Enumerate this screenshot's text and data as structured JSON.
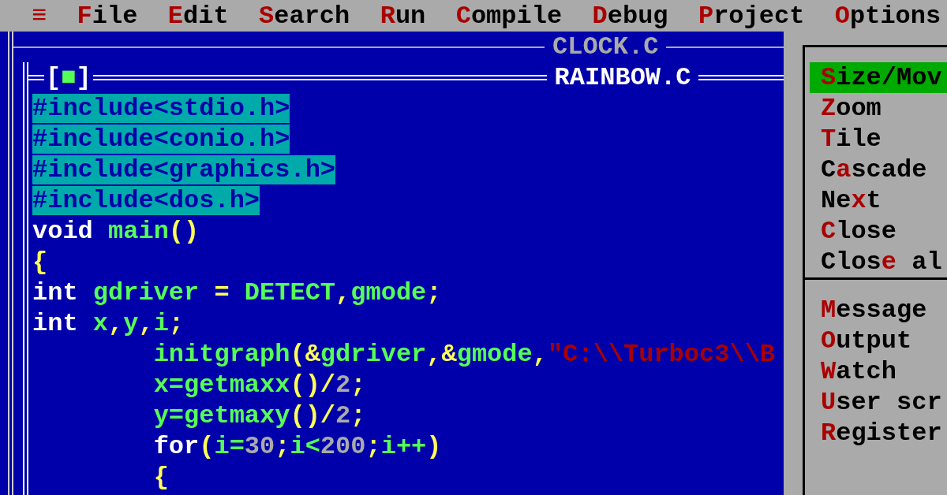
{
  "menu_bar": [
    {
      "key": "≡"
    },
    {
      "key": "F",
      "post": "ile"
    },
    {
      "key": "E",
      "post": "dit"
    },
    {
      "key": "S",
      "post": "earch"
    },
    {
      "key": "R",
      "post": "un"
    },
    {
      "key": "C",
      "post": "ompile"
    },
    {
      "key": "D",
      "post": "ebug"
    },
    {
      "key": "P",
      "post": "roject"
    },
    {
      "key": "O",
      "post": "ptions"
    }
  ],
  "windows": [
    {
      "title": "CLOCK.C",
      "active": false
    },
    {
      "title": "RAINBOW.C",
      "active": true,
      "close_box": {
        "open": "[",
        "mark": "■",
        "close": "]"
      }
    }
  ],
  "code_lines": [
    {
      "selected": true,
      "indented": false,
      "tokens": [
        {
          "kind": "pre",
          "text": "#include<stdio.h>"
        }
      ]
    },
    {
      "selected": true,
      "indented": false,
      "tokens": [
        {
          "kind": "pre",
          "text": "#include<conio.h>"
        }
      ]
    },
    {
      "selected": true,
      "indented": false,
      "tokens": [
        {
          "kind": "pre",
          "text": "#include<graphics.h>"
        }
      ]
    },
    {
      "selected": true,
      "indented": false,
      "tokens": [
        {
          "kind": "pre",
          "text": "#include<dos.h>"
        }
      ]
    },
    {
      "selected": false,
      "indented": false,
      "tokens": [
        {
          "kind": "kw",
          "text": "void "
        },
        {
          "kind": "id",
          "text": "main"
        },
        {
          "kind": "sym",
          "text": "()"
        }
      ]
    },
    {
      "selected": false,
      "indented": false,
      "tokens": [
        {
          "kind": "sym",
          "text": "{"
        }
      ]
    },
    {
      "selected": false,
      "indented": false,
      "tokens": [
        {
          "kind": "kw",
          "text": "int "
        },
        {
          "kind": "id",
          "text": "gdriver "
        },
        {
          "kind": "sym",
          "text": "= "
        },
        {
          "kind": "id",
          "text": "DETECT"
        },
        {
          "kind": "sym",
          "text": ","
        },
        {
          "kind": "id",
          "text": "gmode"
        },
        {
          "kind": "sym",
          "text": ";"
        }
      ]
    },
    {
      "selected": false,
      "indented": false,
      "tokens": [
        {
          "kind": "kw",
          "text": "int "
        },
        {
          "kind": "id",
          "text": "x"
        },
        {
          "kind": "sym",
          "text": ","
        },
        {
          "kind": "id",
          "text": "y"
        },
        {
          "kind": "sym",
          "text": ","
        },
        {
          "kind": "id",
          "text": "i"
        },
        {
          "kind": "sym",
          "text": ";"
        }
      ]
    },
    {
      "selected": false,
      "indented": true,
      "tokens": [
        {
          "kind": "id",
          "text": "initgraph"
        },
        {
          "kind": "sym",
          "text": "(&"
        },
        {
          "kind": "id",
          "text": "gdriver"
        },
        {
          "kind": "sym",
          "text": ",&"
        },
        {
          "kind": "id",
          "text": "gmode"
        },
        {
          "kind": "sym",
          "text": ","
        },
        {
          "kind": "str",
          "text": "\"C:\\\\Turboc3\\\\B"
        }
      ]
    },
    {
      "selected": false,
      "indented": true,
      "tokens": [
        {
          "kind": "id",
          "text": "x=getmaxx"
        },
        {
          "kind": "sym",
          "text": "()/"
        },
        {
          "kind": "num",
          "text": "2"
        },
        {
          "kind": "sym",
          "text": ";"
        }
      ]
    },
    {
      "selected": false,
      "indented": true,
      "tokens": [
        {
          "kind": "id",
          "text": "y=getmaxy"
        },
        {
          "kind": "sym",
          "text": "()/"
        },
        {
          "kind": "num",
          "text": "2"
        },
        {
          "kind": "sym",
          "text": ";"
        }
      ]
    },
    {
      "selected": false,
      "indented": true,
      "tokens": [
        {
          "kind": "kw",
          "text": "for"
        },
        {
          "kind": "sym",
          "text": "("
        },
        {
          "kind": "id",
          "text": "i="
        },
        {
          "kind": "num",
          "text": "30"
        },
        {
          "kind": "sym",
          "text": ";"
        },
        {
          "kind": "id",
          "text": "i<"
        },
        {
          "kind": "num",
          "text": "200"
        },
        {
          "kind": "sym",
          "text": ";"
        },
        {
          "kind": "id",
          "text": "i++"
        },
        {
          "kind": "sym",
          "text": ")"
        }
      ]
    },
    {
      "selected": false,
      "indented": true,
      "tokens": [
        {
          "kind": "sym",
          "text": "{"
        }
      ]
    }
  ],
  "window_menu": {
    "groups": [
      {
        "items": [
          {
            "key": "S",
            "post": "ize/Mov",
            "selected": true
          },
          {
            "key": "Z",
            "post": "oom",
            "selected": false
          },
          {
            "key": "T",
            "post": "ile",
            "selected": false
          },
          {
            "pre": "C",
            "key": "a",
            "post": "scade",
            "selected": false
          },
          {
            "pre": "Ne",
            "key": "x",
            "post": "t",
            "selected": false
          },
          {
            "key": "C",
            "post": "lose",
            "selected": false
          },
          {
            "pre": "Clos",
            "key": "e",
            "post": " al",
            "selected": false
          }
        ]
      },
      {
        "items": [
          {
            "key": "M",
            "post": "essage",
            "selected": false
          },
          {
            "key": "O",
            "post": "utput",
            "selected": false
          },
          {
            "key": "W",
            "post": "atch",
            "selected": false
          },
          {
            "key": "U",
            "post": "ser scr",
            "selected": false
          },
          {
            "key": "R",
            "post": "egister",
            "selected": false
          }
        ]
      }
    ]
  }
}
